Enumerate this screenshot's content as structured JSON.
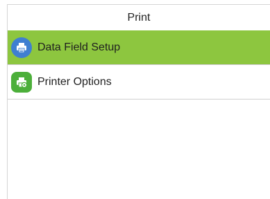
{
  "header": {
    "title": "Print"
  },
  "menu": {
    "items": [
      {
        "label": "Data Field Setup",
        "icon": "printer-icon",
        "selected": true,
        "icon_color": "#3f7fd1"
      },
      {
        "label": "Printer Options",
        "icon": "printer-settings-icon",
        "selected": false,
        "icon_color": "#4caf3a"
      }
    ]
  },
  "colors": {
    "selected_row": "#8dc63f",
    "divider": "#cfcfcf"
  }
}
